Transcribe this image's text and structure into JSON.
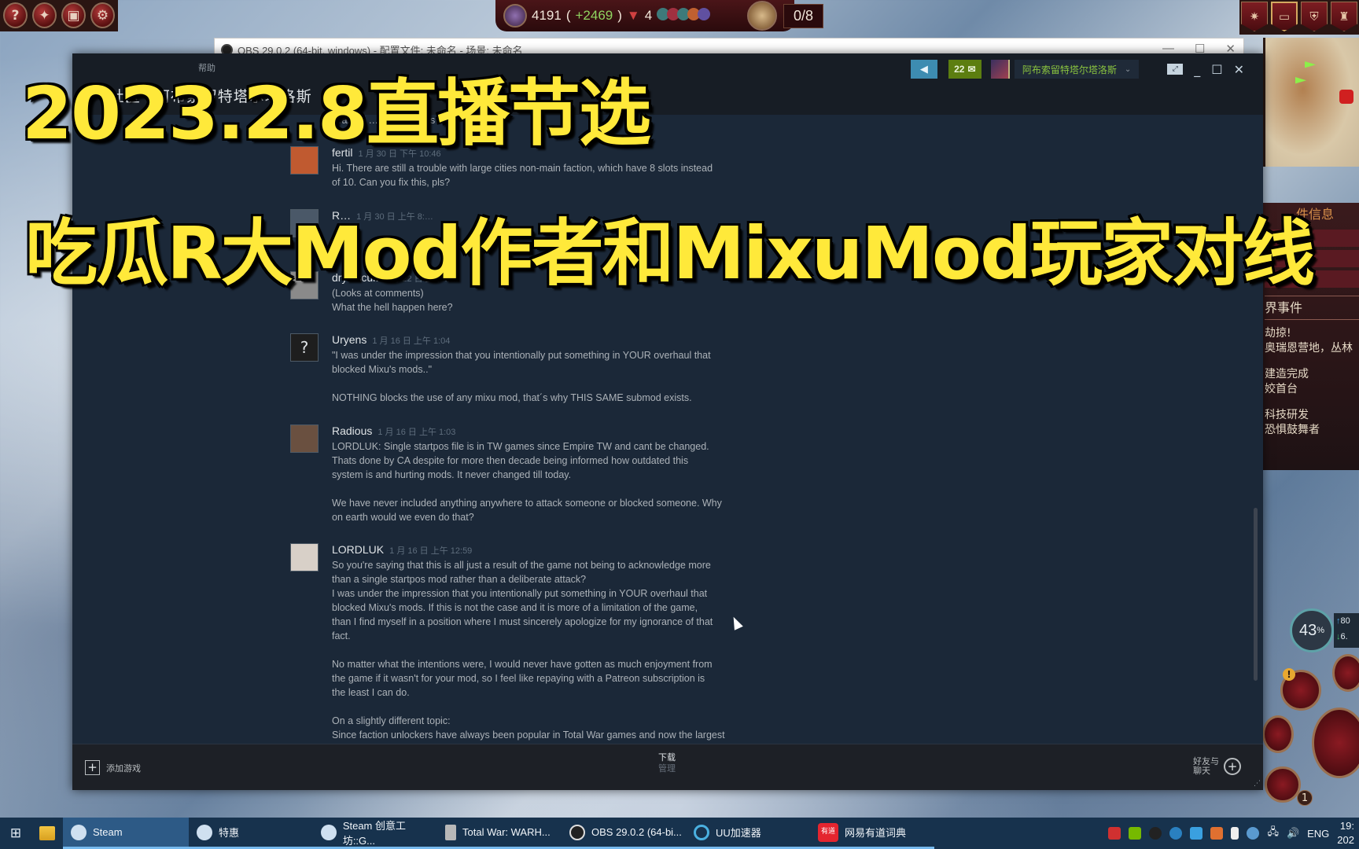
{
  "game_hud": {
    "top_left_buttons": [
      {
        "icon": "help-icon",
        "glyph": "?"
      },
      {
        "icon": "diplomacy-icon",
        "glyph": "✦"
      },
      {
        "icon": "camera-icon",
        "glyph": "▣"
      },
      {
        "icon": "settings-icon",
        "glyph": "⚙"
      }
    ],
    "resources": {
      "treasury": "4191",
      "income_prefix": "(",
      "income": "+2469",
      "income_suffix": ")",
      "blood_count": "4",
      "book_progress": "0/8"
    },
    "top_right_nav": [
      {
        "icon": "compass-icon",
        "glyph": "✷"
      },
      {
        "icon": "chest-icon",
        "glyph": "▭"
      },
      {
        "icon": "shield-crest-icon",
        "glyph": "⛨"
      },
      {
        "icon": "castle-icon",
        "glyph": "♜"
      }
    ],
    "event_panel": {
      "title": "件信息",
      "section_heading": "界事件",
      "items": [
        {
          "line1": "劫掠!",
          "line2": "奥瑞恩营地，丛林"
        },
        {
          "line1": "建造完成",
          "line2": "姣首台"
        },
        {
          "line1": "科技研发",
          "line2": "恐惧鼓舞者"
        }
      ]
    },
    "cpu_gauge": {
      "value": "43",
      "unit": "%"
    },
    "network": {
      "up": "80",
      "down": "6."
    },
    "badges": {
      "warning": "!",
      "count": "1"
    }
  },
  "obs_window": {
    "title": "OBS 29.0.2 (64-bit, windows) - 配置文件: 未命名 - 场景: 未命名",
    "controls": {
      "minimize": "—",
      "maximize": "☐",
      "close": "✕"
    }
  },
  "caption": {
    "line1": "2023.2.8直播节选",
    "line2": "吃瓜R大Mod作者和MixuMod玩家对线"
  },
  "steam": {
    "menu_help": "帮助",
    "nav": {
      "back": "←",
      "tabs": [
        "社区",
        "阿布索留特塔尔塔洛斯"
      ]
    },
    "announce_icon": "◀",
    "notifications": {
      "count": "22",
      "icon": "✉"
    },
    "user_name": "阿布索留特塔尔塔洛斯",
    "user_caret": "⌄",
    "window_controls": {
      "big_picture": "⤢",
      "minimize": "_",
      "maximize": "☐",
      "close": "✕"
    },
    "partial_top_text": "…abled … will ov… …s stuff",
    "comments": [
      {
        "author": "fertil",
        "time": "1 月 30 日 下午 10:46",
        "avatar_color": "#c05a30",
        "text": "Hi. There are still a trouble with large cities non-main faction, which have 8 slots instead\nof 10. Can you fix this, pls?"
      },
      {
        "author": "R…",
        "time": "1 月 30 日 上午 8:…",
        "avatar_color": "#4a5868",
        "text": "…\n…"
      },
      {
        "author": "drybiscuit",
        "time": "1 月 22 日 上午 1…",
        "avatar_color": "#8a8a8a",
        "text": "(Looks at comments)\nWhat the hell happen here?"
      },
      {
        "author": "Uryens",
        "time": "1 月 16 日 上午 1:04",
        "avatar_color": "#1e1e1e",
        "avatar_glyph": "?",
        "text": "\"I was under the impression that you intentionally put something in YOUR overhaul that\nblocked Mixu's mods..\"\n\nNOTHING blocks the use of any mixu mod, that´s why THIS SAME submod exists."
      },
      {
        "author": "Radious",
        "time": "1 月 16 日 上午 1:03",
        "avatar_color": "#6a5040",
        "text": "LORDLUK: Single startpos file is in TW games since Empire TW and cant be changed.\nThats done by CA despite for more then decade being informed how outdated this\nsystem is and hurting mods. It never changed till today.\n\nWe have never included anything anywhere to attack someone or blocked someone. Why\non earth would we even do that?"
      },
      {
        "author": "LORDLUK",
        "time": "1 月 16 日 上午 12:59",
        "avatar_color": "#d8d0c8",
        "text": "So you're saying that this is all just a result of the game not being to acknowledge more\nthan a single startpos mod rather than a deliberate attack?\nI was under the impression that you intentionally put something in YOUR overhaul that\nblocked Mixu's mods. If this is not the case and it is more of a limitation of the game,\nthan I find myself in a position where I must sincerely apologize for my ignorance of that\nfact.\n\nNo matter what the intentions were, I would never have gotten as much enjoyment from\nthe game if it wasn't for your mod, so I feel like repaying with a Patreon subscription is\nthe least I can do.\n\nOn a slightly different topic:\nSince faction unlockers have always been popular in Total War games and now the largest"
      }
    ],
    "bottom_bar": {
      "add_game": "添加游戏",
      "downloads": "下载",
      "downloads_sub": "管理",
      "friends_line1": "好友与",
      "friends_line2": "聊天"
    }
  },
  "taskbar": {
    "apps": [
      {
        "label": "Steam",
        "icon": "steam-icon",
        "active": true
      },
      {
        "label": "特惠",
        "icon": "steam-icon"
      },
      {
        "label": "Steam 创意工坊::G...",
        "icon": "steam-icon"
      },
      {
        "label": "Total War: WARH...",
        "icon": "totalwar-icon"
      },
      {
        "label": "OBS 29.0.2 (64-bi...",
        "icon": "obs-icon"
      },
      {
        "label": "UU加速器",
        "icon": "uu-icon"
      },
      {
        "label": "网易有道词典",
        "icon": "youdao-icon",
        "icon_text": "有道"
      }
    ],
    "tray": {
      "language": "ENG",
      "time": "19:",
      "date": "202"
    }
  }
}
